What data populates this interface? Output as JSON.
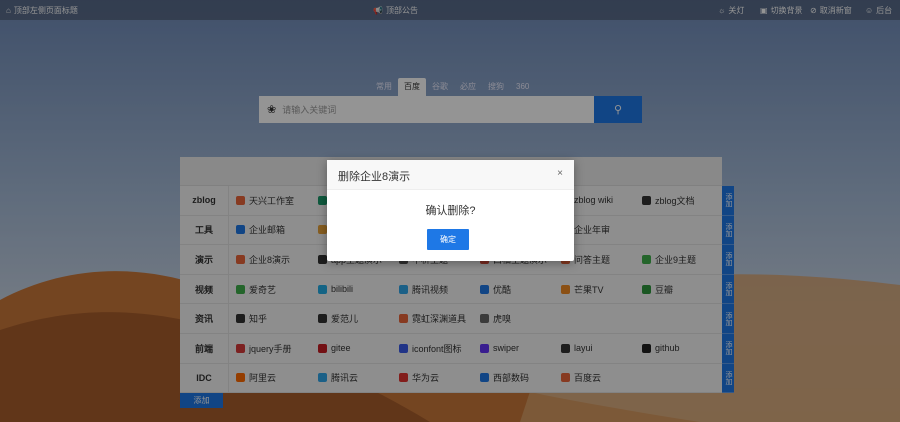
{
  "topbar": {
    "left": "顶部左侧页面标题",
    "center": "顶部公告",
    "right": [
      {
        "icon": "lightbulb-icon",
        "label": "关灯"
      },
      {
        "icon": "image-icon",
        "label": "切换背景"
      },
      {
        "icon": "link-icon",
        "label": "取消新窗"
      },
      {
        "icon": "user-icon",
        "label": "后台"
      }
    ]
  },
  "search": {
    "tabs": [
      "常用",
      "百度",
      "谷歌",
      "必应",
      "搜狗",
      "360"
    ],
    "active_tab": "百度",
    "placeholder": "请输入关键词"
  },
  "rows": [
    {
      "label": "zblog",
      "add": "添加",
      "links": [
        {
          "name": "天兴工作室",
          "color": "#e8643a"
        },
        {
          "name": "",
          "color": "#1a9b6c"
        },
        {
          "name": "",
          "color": ""
        },
        {
          "name": "",
          "color": ""
        },
        {
          "name": "zblog wiki",
          "color": "#333333"
        },
        {
          "name": "zblog文档",
          "color": "#333333"
        }
      ]
    },
    {
      "label": "工具",
      "add": "添加",
      "links": [
        {
          "name": "企业邮箱",
          "color": "#1e78e6"
        },
        {
          "name": "",
          "color": "#e8a33a"
        },
        {
          "name": "",
          "color": ""
        },
        {
          "name": "",
          "color": ""
        },
        {
          "name": "企业年审",
          "color": "#333333"
        },
        {
          "name": "",
          "color": ""
        }
      ]
    },
    {
      "label": "演示",
      "add": "添加",
      "links": [
        {
          "name": "企业8演示",
          "color": "#e8643a"
        },
        {
          "name": "app主题演示",
          "color": "#333333"
        },
        {
          "name": "中析主题",
          "color": "#555555"
        },
        {
          "name": "西柚主题演示",
          "color": "#d44a3a"
        },
        {
          "name": "问答主题",
          "color": "#e8643a"
        },
        {
          "name": "企业9主题",
          "color": "#3fae4b"
        }
      ]
    },
    {
      "label": "视频",
      "add": "添加",
      "links": [
        {
          "name": "爱奇艺",
          "color": "#3fae4b"
        },
        {
          "name": "bilibili",
          "color": "#23ade5"
        },
        {
          "name": "腾讯视频",
          "color": "#2fa5e8"
        },
        {
          "name": "优酷",
          "color": "#1e78e6"
        },
        {
          "name": "芒果TV",
          "color": "#f08a24"
        },
        {
          "name": "豆瓣",
          "color": "#2e963d"
        }
      ]
    },
    {
      "label": "资讯",
      "add": "添加",
      "links": [
        {
          "name": "知乎",
          "color": "#333333"
        },
        {
          "name": "爱范儿",
          "color": "#333333"
        },
        {
          "name": "霓虹深渊道具",
          "color": "#e8643a"
        },
        {
          "name": "虎嗅",
          "color": "#666666"
        },
        {
          "name": "",
          "color": ""
        },
        {
          "name": "",
          "color": ""
        }
      ]
    },
    {
      "label": "前端",
      "add": "添加",
      "links": [
        {
          "name": "jquery手册",
          "color": "#d63a3a"
        },
        {
          "name": "gitee",
          "color": "#c71d23"
        },
        {
          "name": "iconfont图标",
          "color": "#3a5be8"
        },
        {
          "name": "swiper",
          "color": "#6332f6"
        },
        {
          "name": "layui",
          "color": "#333333"
        },
        {
          "name": "github",
          "color": "#222222"
        }
      ]
    },
    {
      "label": "IDC",
      "add": "添加",
      "links": [
        {
          "name": "阿里云",
          "color": "#ff6a00"
        },
        {
          "name": "腾讯云",
          "color": "#2fa5e8"
        },
        {
          "name": "华为云",
          "color": "#e0332f"
        },
        {
          "name": "西部数码",
          "color": "#1e78e6"
        },
        {
          "name": "百度云",
          "color": "#e8643a"
        },
        {
          "name": "",
          "color": ""
        }
      ]
    }
  ],
  "add_category": "添加",
  "modal": {
    "title": "删除企业8演示",
    "close": "×",
    "message": "确认删除?",
    "confirm": "确定"
  },
  "colors": {
    "accent": "#1e78e6"
  }
}
